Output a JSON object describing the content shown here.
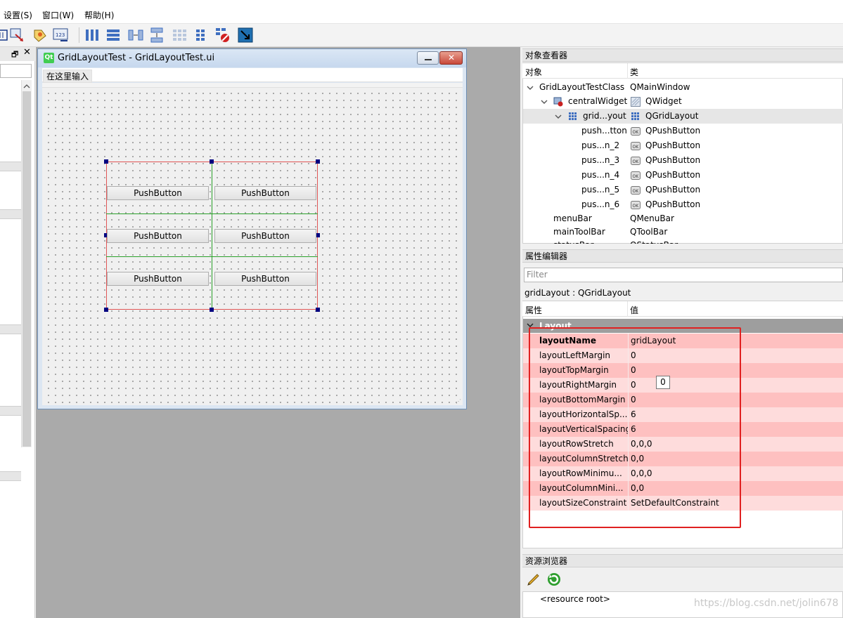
{
  "menu": {
    "settings": "设置(S)",
    "window": "窗口(W)",
    "help": "帮助(H)"
  },
  "form": {
    "title": "GridLayoutTest - GridLayoutTest.ui",
    "menu_placeholder": "在这里输入",
    "buttons": [
      "PushButton",
      "PushButton",
      "PushButton",
      "PushButton",
      "PushButton",
      "PushButton"
    ]
  },
  "object_inspector": {
    "title": "对象查看器",
    "col_object": "对象",
    "col_class": "类",
    "rows": [
      {
        "name": "GridLayoutTestClass",
        "cls": "QMainWindow"
      },
      {
        "name": "centralWidget",
        "cls": "QWidget"
      },
      {
        "name": "grid...yout",
        "cls": "QGridLayout"
      },
      {
        "name": "push...tton",
        "cls": "QPushButton"
      },
      {
        "name": "pus...n_2",
        "cls": "QPushButton"
      },
      {
        "name": "pus...n_3",
        "cls": "QPushButton"
      },
      {
        "name": "pus...n_4",
        "cls": "QPushButton"
      },
      {
        "name": "pus...n_5",
        "cls": "QPushButton"
      },
      {
        "name": "pus...n_6",
        "cls": "QPushButton"
      },
      {
        "name": "menuBar",
        "cls": "QMenuBar"
      },
      {
        "name": "mainToolBar",
        "cls": "QToolBar"
      },
      {
        "name": "statusBar",
        "cls": "QStatusBar"
      }
    ]
  },
  "property_editor": {
    "title": "属性编辑器",
    "filter_placeholder": "Filter",
    "object_label": "gridLayout : QGridLayout",
    "col_property": "属性",
    "col_value": "值",
    "group": "Layout",
    "tooltip": "0",
    "rows": [
      {
        "name": "layoutName",
        "value": "gridLayout",
        "bold": true
      },
      {
        "name": "layoutLeftMargin",
        "value": "0"
      },
      {
        "name": "layoutTopMargin",
        "value": "0"
      },
      {
        "name": "layoutRightMargin",
        "value": "0"
      },
      {
        "name": "layoutBottomMargin",
        "value": "0"
      },
      {
        "name": "layoutHorizontalSp...",
        "value": "6"
      },
      {
        "name": "layoutVerticalSpacing",
        "value": "6"
      },
      {
        "name": "layoutRowStretch",
        "value": "0,0,0"
      },
      {
        "name": "layoutColumnStretch",
        "value": "0,0"
      },
      {
        "name": "layoutRowMinimu...",
        "value": "0,0,0"
      },
      {
        "name": "layoutColumnMini...",
        "value": "0,0"
      },
      {
        "name": "layoutSizeConstraint",
        "value": "SetDefaultConstraint"
      }
    ]
  },
  "resource_browser": {
    "title": "资源浏览器",
    "root": "<resource root>"
  },
  "watermark": "https://blog.csdn.net/jolin678"
}
